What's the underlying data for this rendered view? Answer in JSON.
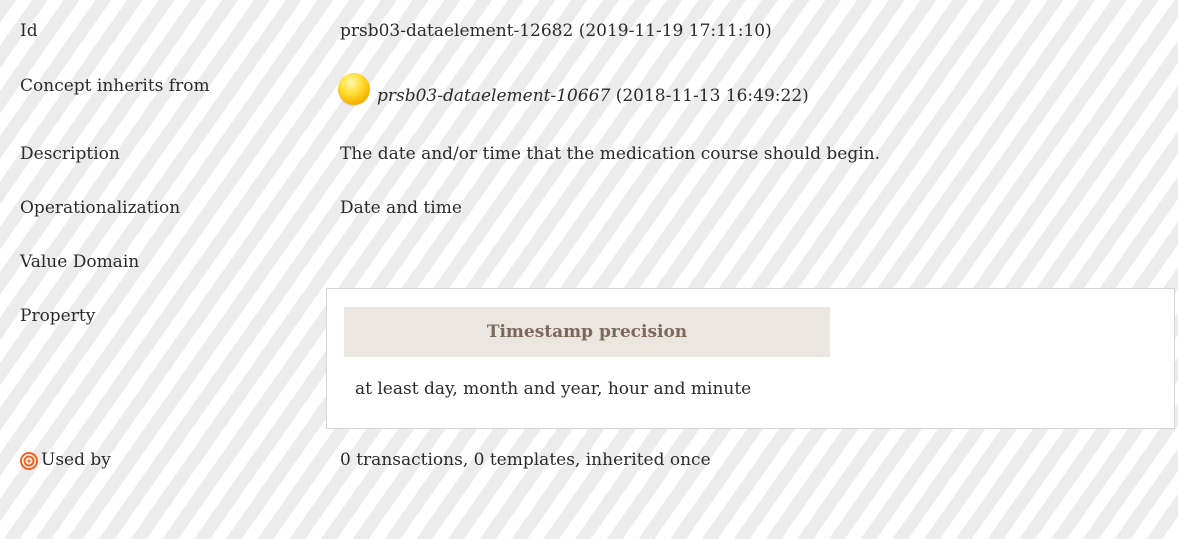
{
  "rows": {
    "id": {
      "label": "Id",
      "value": "prsb03-dataelement-12682 (2019-11-19 17:11:10)"
    },
    "inherits": {
      "label": "Concept inherits from",
      "ref_id": "prsb03-dataelement-10667",
      "ref_date": " (2018-11-13 16:49:22)",
      "icon": "yellow-circle-icon"
    },
    "description": {
      "label": "Description",
      "value": "The date and/or time that the medication course should begin."
    },
    "operationalization": {
      "label": "Operationalization",
      "value": "Date and time"
    },
    "value_domain": {
      "label": "Value Domain"
    },
    "property": {
      "label": "Property",
      "header": "Timestamp precision",
      "value": "at least day, month and year, hour and minute"
    },
    "used_by": {
      "label": "Used by",
      "value": "0 transactions, 0 templates, inherited once",
      "icon": "target-icon"
    }
  },
  "colors": {
    "stripe": "#ececec",
    "header_bg": "#ebe6df",
    "header_text": "#7a6a5c",
    "target_icon": "#f0641e"
  }
}
